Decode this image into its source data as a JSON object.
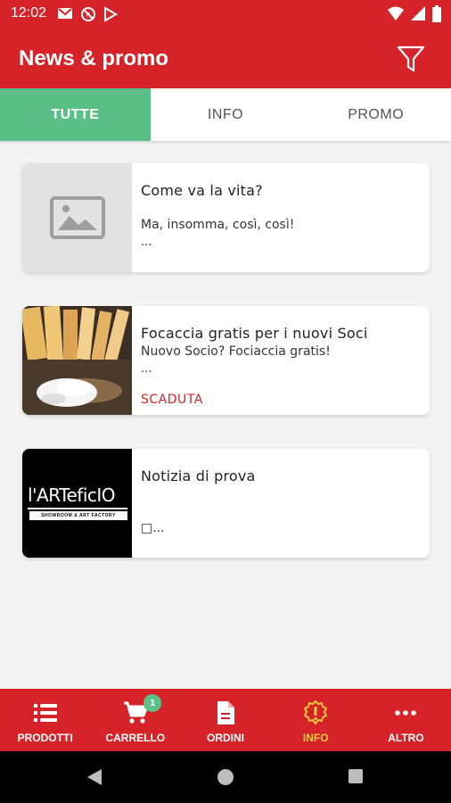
{
  "status_bar": {
    "time": "12:02",
    "icons": [
      "gmail-icon",
      "no-sim-icon",
      "play-store-icon"
    ],
    "right_icons": [
      "wifi-icon",
      "cellular-icon",
      "battery-icon"
    ]
  },
  "app_bar": {
    "title": "News & promo",
    "filter_icon": "filter-icon"
  },
  "tabs": [
    {
      "label": "TUTTE",
      "active": true
    },
    {
      "label": "INFO",
      "active": false
    },
    {
      "label": "PROMO",
      "active": false
    }
  ],
  "cards": [
    {
      "title": "Come va la vita?",
      "subtitle": "Ma, insomma, così, così!",
      "more": "...",
      "status": "",
      "image": "placeholder-image-icon"
    },
    {
      "title": "Focaccia gratis per i nuovi Soci",
      "subtitle": "Nuovo Socio? Fociaccia gratis!",
      "more": "...",
      "status": "SCADUTA",
      "image": "focaccia-photo"
    },
    {
      "title": "Notizia di prova",
      "subtitle": "",
      "more": "□...",
      "status": "",
      "image": "artefficio-logo",
      "logo_text": "l'ARTeficIO",
      "logo_sub": "SHOWROOM & ART FACTORY"
    }
  ],
  "bottom_nav": [
    {
      "label": "PRODOTTI",
      "icon": "list-icon",
      "active": false
    },
    {
      "label": "CARRELLO",
      "icon": "cart-icon",
      "active": false,
      "badge": "1"
    },
    {
      "label": "ORDINI",
      "icon": "document-icon",
      "active": false
    },
    {
      "label": "INFO",
      "icon": "info-badge-icon",
      "active": true
    },
    {
      "label": "ALTRO",
      "icon": "more-icon",
      "active": false
    }
  ],
  "colors": {
    "brand": "#d62329",
    "tab_active": "#5cbf88",
    "nav_active": "#e8c940",
    "expired": "#d62329"
  }
}
